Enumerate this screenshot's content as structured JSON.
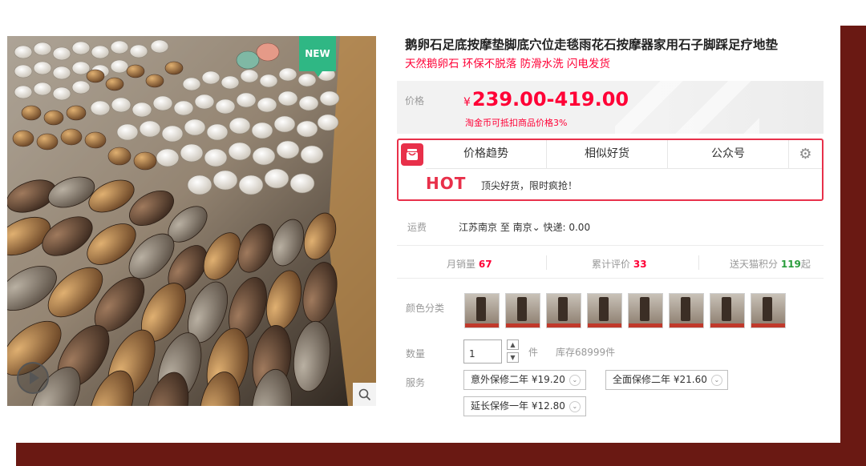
{
  "product": {
    "title": "鹅卵石足底按摩垫脚底穴位走毯雨花石按摩器家用石子脚踩足疗地垫",
    "subtitle": "天然鹅卵石 环保不脱落 防滑水洗 闪电发货",
    "badge_new": "NEW"
  },
  "price": {
    "label": "价格",
    "currency": "¥",
    "value": "239.00-419.00",
    "coin_note": "淘金币可抵扣商品价格3%"
  },
  "plugin": {
    "tabs": [
      "价格趋势",
      "相似好货",
      "公众号"
    ],
    "hot_label": "HOT",
    "hot_text": "顶尖好货，限时疯抢！"
  },
  "shipping": {
    "label": "运费",
    "value": "江苏南京 至 南京⌄ 快递: 0.00"
  },
  "stats": {
    "monthly_sales_label": "月销量",
    "monthly_sales": "67",
    "reviews_label": "累计评价",
    "reviews": "33",
    "points_label": "送天猫积分",
    "points": "119",
    "points_suffix": "起"
  },
  "color": {
    "label": "颜色分类",
    "swatch_count": 8
  },
  "quantity": {
    "label": "数量",
    "value": "1",
    "unit": "件",
    "stock": "库存68999件"
  },
  "service": {
    "label": "服务",
    "options": [
      {
        "name": "意外保修二年",
        "price": "¥19.20"
      },
      {
        "name": "全面保修二年",
        "price": "¥21.60"
      },
      {
        "name": "延长保修一年",
        "price": "¥12.80"
      }
    ]
  },
  "icons": {
    "zoom": "search-icon",
    "play": "play-icon",
    "settings": "gear-icon"
  },
  "colors": {
    "accent": "#ff0036",
    "plugin_border": "#e8304a",
    "new_badge": "#2fb784",
    "frame": "#6a1913"
  }
}
